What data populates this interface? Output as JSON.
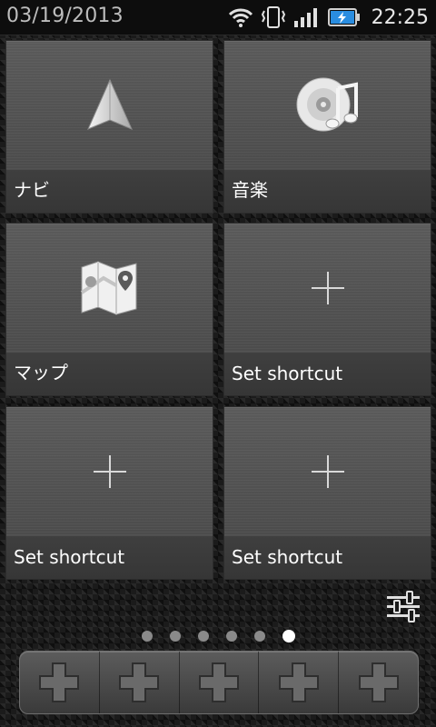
{
  "status_bar": {
    "date": "03/19/2013",
    "time": "22:25",
    "icons": [
      "wifi-icon",
      "vibrate-icon",
      "signal-icon",
      "battery-charging-icon"
    ]
  },
  "tiles": [
    {
      "label": "ナビ",
      "icon": "navigation-arrow-icon"
    },
    {
      "label": "音楽",
      "icon": "music-disc-icon"
    },
    {
      "label": "マップ",
      "icon": "maps-icon"
    },
    {
      "label": "Set shortcut",
      "icon": "plus-icon"
    },
    {
      "label": "Set shortcut",
      "icon": "plus-icon"
    },
    {
      "label": "Set shortcut",
      "icon": "plus-icon"
    }
  ],
  "settings": {
    "icon": "sliders-icon"
  },
  "pager": {
    "count": 6,
    "active_index": 5
  },
  "dock": {
    "slots": 5,
    "icon": "add-icon"
  },
  "colors": {
    "tile": "#4f4f4f",
    "label_bar": "#3a3a3a",
    "accent_battery": "#2a8de0"
  }
}
